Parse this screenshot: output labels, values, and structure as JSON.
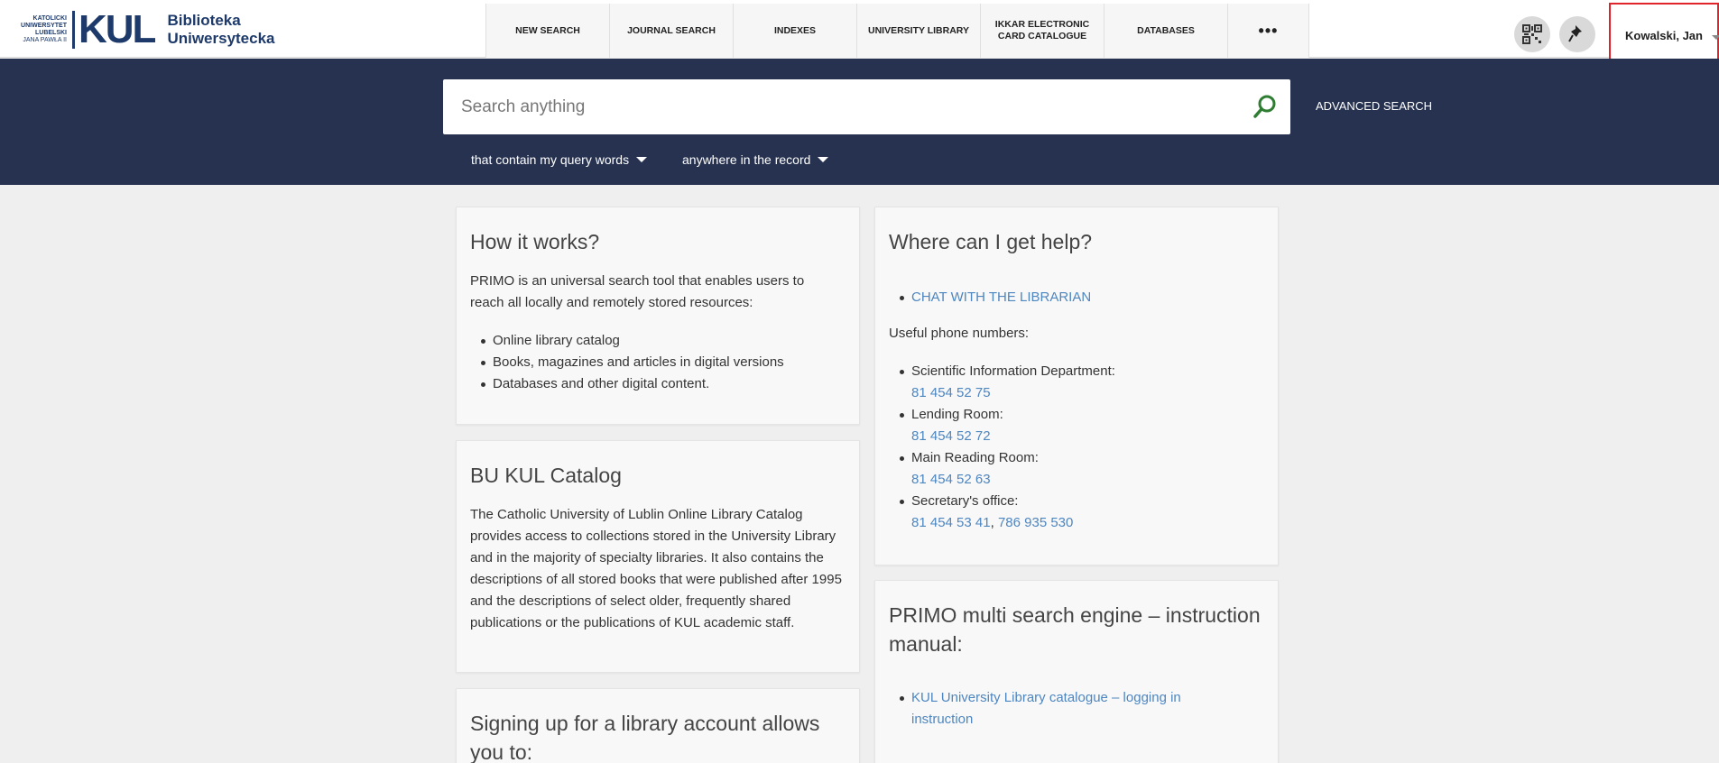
{
  "logo": {
    "small_lines": [
      "KATOLICKI",
      "UNIWERSYTET",
      "LUBELSKI",
      "JANA PAWŁA II"
    ],
    "mark": "KUL",
    "name_line1": "Biblioteka",
    "name_line2": "Uniwersytecka"
  },
  "nav": {
    "items": [
      {
        "label": "NEW SEARCH"
      },
      {
        "label": "JOURNAL SEARCH"
      },
      {
        "label": "INDEXES"
      },
      {
        "label": "UNIVERSITY LIBRARY"
      },
      {
        "label": "IKKAR ELECTRONIC CARD CATALOGUE"
      },
      {
        "label": "DATABASES"
      }
    ],
    "more_label": "•••"
  },
  "user": {
    "name": "Kowalski, Jan"
  },
  "search": {
    "placeholder": "Search anything",
    "advanced_label": "ADVANCED SEARCH",
    "filter_match": "that contain my query words",
    "filter_scope": "anywhere in the record"
  },
  "how": {
    "title": "How it works?",
    "text": "PRIMO is an universal search tool that enables users to reach all locally and remotely stored resources:",
    "items": [
      "Online library catalog",
      "Books, magazines and articles in digital versions",
      "Databases and other digital content."
    ]
  },
  "kul": {
    "title": "BU KUL Catalog",
    "text": "The Catholic University of Lublin Online Library Catalog provides access to collections stored in the University Library and in the majority of specialty libraries. It also contains the descriptions of all stored books that were published after 1995 and the descriptions of select older, frequently shared publications or the publications of KUL academic staff."
  },
  "sign": {
    "title": "Signing up for a library account allows you to:"
  },
  "help": {
    "title": "Where can I get help?",
    "chat_label": "CHAT WITH THE LIBRARIAN",
    "phones_label": "Useful phone numbers:",
    "phones": [
      {
        "name": "Scientific Information Department:",
        "number": "81 454 52 75"
      },
      {
        "name": "Lending Room:",
        "number": "81 454 52 72"
      },
      {
        "name": "Main Reading Room:",
        "number": "81 454 52 63"
      },
      {
        "name": "Secretary's office:",
        "number": "81 454 53 41",
        "number2": "786 935 530"
      }
    ]
  },
  "primo": {
    "title": "PRIMO multi search engine – instruction manual:",
    "link": "KUL University Library catalogue – logging in instruction"
  },
  "colors": {
    "header_band": "#263250",
    "accent_link": "#4e86c0",
    "search_icon": "#2e7d32",
    "highlight_border": "#e0242b"
  }
}
